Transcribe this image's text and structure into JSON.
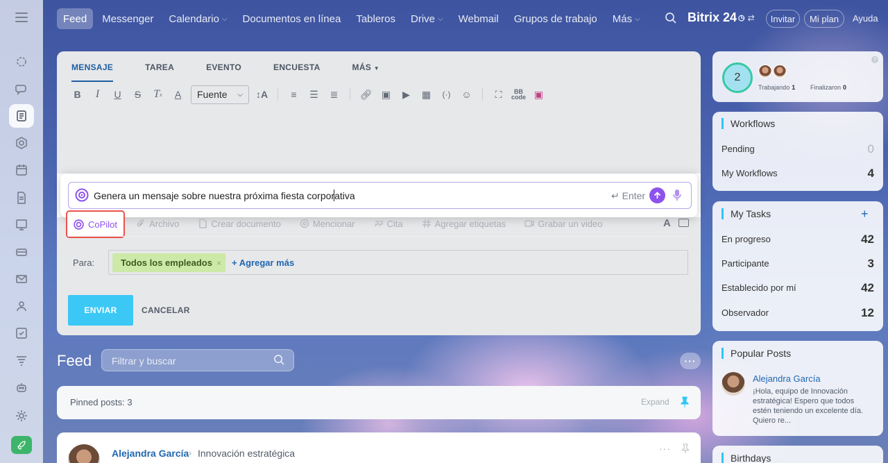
{
  "topnav": {
    "items": [
      "Feed",
      "Messenger",
      "Calendario",
      "Documentos en línea",
      "Tableros",
      "Drive",
      "Webmail",
      "Grupos de trabajo",
      "Más"
    ],
    "active_index": 0,
    "brand": "Bitrix 24",
    "invite_label": "Invitar",
    "plan_label": "Mi plan",
    "help_label": "Ayuda"
  },
  "composer": {
    "tabs": [
      "MENSAJE",
      "TAREA",
      "EVENTO",
      "ENCUESTA",
      "MÁS"
    ],
    "font_select": "Fuente",
    "copilot_prompt": "Genera un mensaje sobre nuestra próxima fiesta corporativa",
    "enter_hint": "Enter",
    "copilot_button": "CoPilot",
    "extras": [
      "Archivo",
      "Crear documento",
      "Mencionar",
      "Cita",
      "Agregar etiquetas",
      "Grabar un video"
    ],
    "to_label": "Para:",
    "recipient": "Todos los empleados",
    "add_more": "+ Agregar más",
    "send": "ENVIAR",
    "cancel": "CANCELAR"
  },
  "feed": {
    "title": "Feed",
    "search_placeholder": "Filtrar y buscar",
    "pinned_label": "Pinned posts: 3",
    "expand_label": "Expand",
    "post": {
      "author": "Alejandra García",
      "group": "Innovación estratégica"
    }
  },
  "sidebar_right": {
    "stats": {
      "count": "2",
      "working_label": "Trabajando",
      "working_value": "1",
      "finished_label": "Finalizaron",
      "finished_value": "0"
    },
    "workflows": {
      "title": "Workflows",
      "rows": [
        {
          "label": "Pending",
          "value": "0"
        },
        {
          "label": "My Workflows",
          "value": "4"
        }
      ]
    },
    "tasks": {
      "title": "My Tasks",
      "rows": [
        {
          "label": "En progreso",
          "value": "42"
        },
        {
          "label": "Participante",
          "value": "3"
        },
        {
          "label": "Establecido por mí",
          "value": "42"
        },
        {
          "label": "Observador",
          "value": "12"
        }
      ]
    },
    "popular": {
      "title": "Popular Posts",
      "author": "Alejandra García",
      "excerpt": "¡Hola, equipo de Innovación estratégica! Espero que todos estén teniendo un excelente día. Quiero re..."
    },
    "birthdays": {
      "title": "Birthdays"
    }
  },
  "colors": {
    "accent": "#2067b0",
    "copilot": "#8e52ec",
    "send_button": "#3bc8f5",
    "highlight_border": "#e9534a"
  }
}
